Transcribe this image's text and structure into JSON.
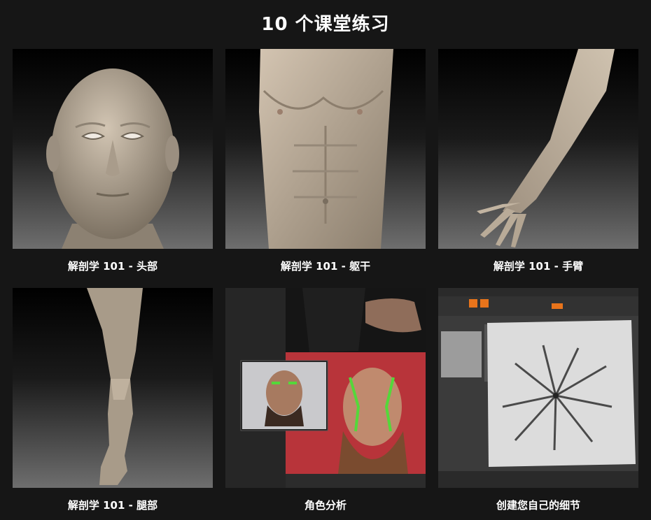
{
  "page": {
    "title": "10 个课堂练习"
  },
  "cards": [
    {
      "caption": "解剖学 101 - 头部",
      "image": "head-sculpt"
    },
    {
      "caption": "解剖学 101 - 躯干",
      "image": "torso-sculpt"
    },
    {
      "caption": "解剖学 101 - 手臂",
      "image": "arm-sculpt"
    },
    {
      "caption": "解剖学 101 - 腿部",
      "image": "leg-sculpt"
    },
    {
      "caption": "角色分析",
      "image": "character-analysis-collage"
    },
    {
      "caption": "创建您自己的细节",
      "image": "zbrush-alpha-detail"
    }
  ],
  "colors": {
    "background": "#161616",
    "text": "#ffffff",
    "clay": "#b4a898",
    "accent_green": "#54d83a",
    "ui_orange": "#e8741b"
  }
}
